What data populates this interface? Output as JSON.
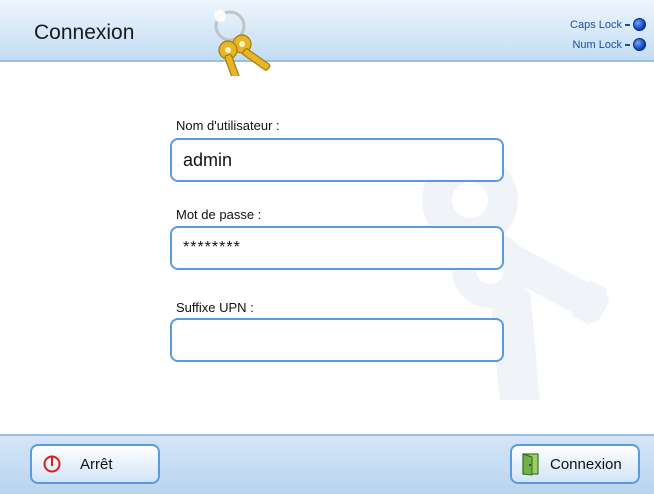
{
  "header": {
    "title": "Connexion",
    "caps_lock_label": "Caps Lock",
    "num_lock_label": "Num Lock"
  },
  "form": {
    "username": {
      "label": "Nom d'utilisateur :",
      "value": "admin"
    },
    "password": {
      "label": "Mot de passe :",
      "value": "********"
    },
    "upn_suffix": {
      "label": "Suffixe UPN :",
      "value": ""
    }
  },
  "footer": {
    "stop_label": "Arrêt",
    "login_label": "Connexion"
  },
  "icons": {
    "logo": "keys-icon",
    "stop": "power-icon",
    "login": "door-exit-icon",
    "indicator": "led-indicator-icon"
  },
  "colors": {
    "accent": "#5a9be0",
    "header_bg": "#d6e8f8",
    "indicator": "#0b3ab6",
    "stop_red": "#d81f1f"
  }
}
